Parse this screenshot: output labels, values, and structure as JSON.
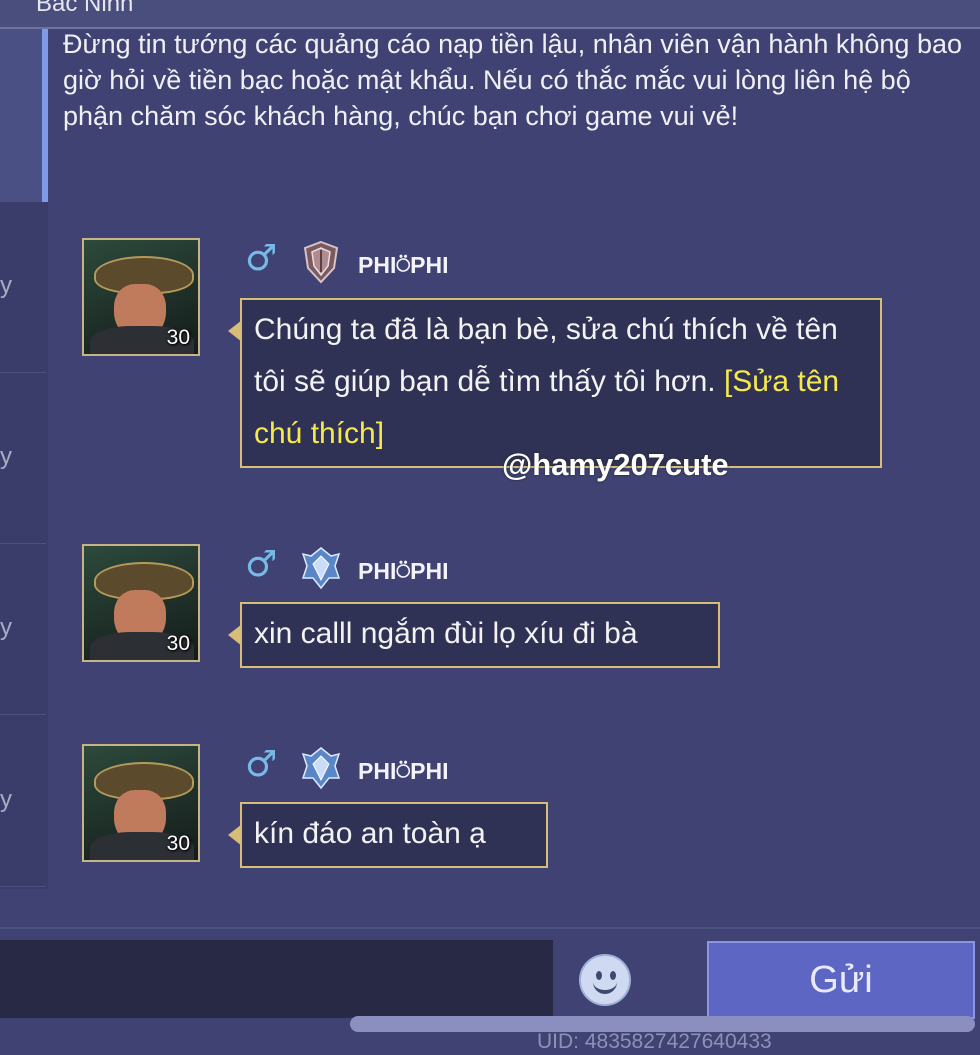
{
  "header": {
    "location": "Bắc Ninh"
  },
  "notice": {
    "text": "Đừng tin tướng các quảng cáo nạp tiền lậu, nhân viên vận hành không bao giờ hỏi về tiền bạc hoặc mật khẩu. Nếu có thắc mắc vui lòng liên hệ bộ phận chăm sóc khách hàng, chúc bạn chơi game vui vẻ!"
  },
  "sidebar": {
    "items": [
      {
        "label": "y"
      },
      {
        "label": "y"
      },
      {
        "label": "y"
      },
      {
        "label": "y"
      }
    ]
  },
  "messages": [
    {
      "sender": "PHI⍥PHI",
      "level": "30",
      "gender": "♂",
      "rank_icon": "shield-rank-icon",
      "text": "Chúng ta đã là bạn bè, sửa chú thích về tên tôi sẽ giúp bạn dễ tìm thấy tôi hơn. ",
      "link": "[Sửa tên chú thích]"
    },
    {
      "sender": "PHI⍥PHI",
      "level": "30",
      "gender": "♂",
      "rank_icon": "crystal-rank-icon",
      "text": "xin calll ngắm đùi lọ xíu đi bà"
    },
    {
      "sender": "PHI⍥PHI",
      "level": "30",
      "gender": "♂",
      "rank_icon": "crystal-rank-icon",
      "text": "kín đáo an toàn ạ"
    }
  ],
  "watermark": "@hamy207cute",
  "input": {
    "value": "",
    "placeholder": ""
  },
  "send_label": "Gửi",
  "uid": "UID: 4835827427640433",
  "colors": {
    "background": "#3f4272",
    "bubble_border": "#d8bd79",
    "link": "#f6e94e",
    "send_button": "#5e66c4"
  }
}
